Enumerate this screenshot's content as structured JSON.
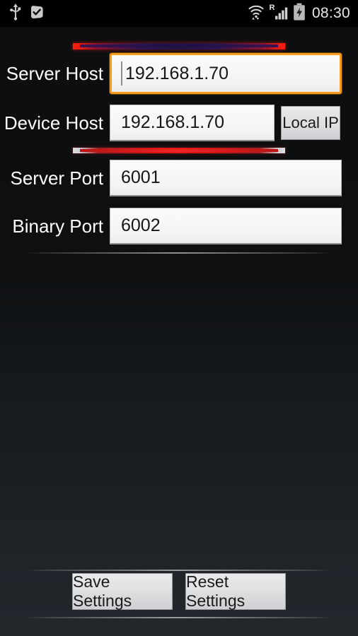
{
  "status_bar": {
    "icons_left": [
      "usb-icon",
      "check-badge-icon"
    ],
    "icons_right": [
      "wifi-icon",
      "roaming-signal-icon",
      "battery-charging-icon"
    ],
    "roaming_letter": "R",
    "clock": "08:30"
  },
  "form": {
    "rows": [
      {
        "label": "Server Host",
        "value": "192.168.1.70",
        "focused": true
      },
      {
        "label": "Device Host",
        "value": "192.168.1.70",
        "focused": false
      },
      {
        "label": "Server Port",
        "value": "6001",
        "focused": false
      },
      {
        "label": "Binary Port",
        "value": "6002",
        "focused": false
      }
    ],
    "local_ip_button": "Local IP"
  },
  "actions": {
    "save": "Save Settings",
    "reset": "Reset Settings"
  },
  "colors": {
    "focus_border": "#f79a1e",
    "deco_bar_red": "#ff1d10",
    "deco_bar_navy": "#231349",
    "field_bg": "#f4f4f4",
    "label_text": "#ffffff",
    "screen_bg_top": "#0a0c0d",
    "screen_bg_bottom": "#23282d"
  }
}
